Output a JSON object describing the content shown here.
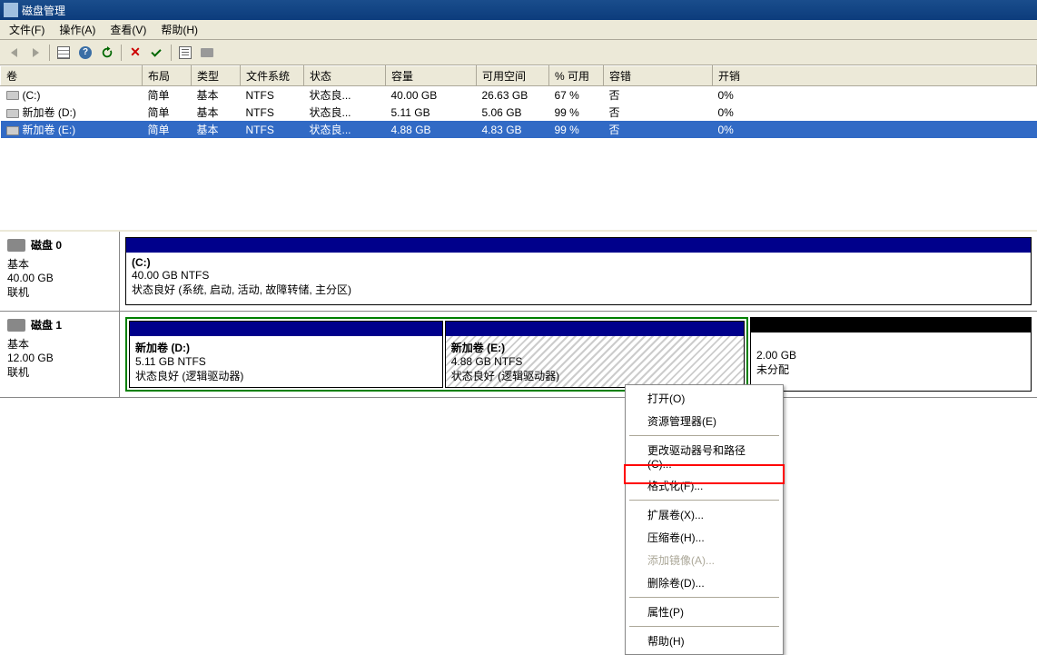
{
  "window": {
    "title": "磁盘管理"
  },
  "menu": {
    "file": "文件(F)",
    "action": "操作(A)",
    "view": "查看(V)",
    "help": "帮助(H)"
  },
  "columns": {
    "volume": "卷",
    "layout": "布局",
    "type": "类型",
    "fs": "文件系统",
    "status": "状态",
    "capacity": "容量",
    "free": "可用空间",
    "pct_free": "% 可用",
    "fault": "容错",
    "overhead": "开销"
  },
  "volumes": [
    {
      "name": "(C:)",
      "layout": "简单",
      "type": "基本",
      "fs": "NTFS",
      "status": "状态良...",
      "capacity": "40.00 GB",
      "free": "26.63 GB",
      "pct": "67 %",
      "fault": "否",
      "overhead": "0%",
      "selected": false
    },
    {
      "name": "新加卷 (D:)",
      "layout": "简单",
      "type": "基本",
      "fs": "NTFS",
      "status": "状态良...",
      "capacity": "5.11 GB",
      "free": "5.06 GB",
      "pct": "99 %",
      "fault": "否",
      "overhead": "0%",
      "selected": false
    },
    {
      "name": "新加卷 (E:)",
      "layout": "简单",
      "type": "基本",
      "fs": "NTFS",
      "status": "状态良...",
      "capacity": "4.88 GB",
      "free": "4.83 GB",
      "pct": "99 %",
      "fault": "否",
      "overhead": "0%",
      "selected": true
    }
  ],
  "disks": {
    "disk0": {
      "title": "磁盘 0",
      "type": "基本",
      "size": "40.00 GB",
      "state": "联机",
      "part_c": {
        "title": "(C:)",
        "line2": "40.00 GB NTFS",
        "line3": "状态良好 (系统, 启动, 活动, 故障转储, 主分区)"
      }
    },
    "disk1": {
      "title": "磁盘 1",
      "type": "基本",
      "size": "12.00 GB",
      "state": "联机",
      "part_d": {
        "title": "新加卷   (D:)",
        "line2": "5.11 GB NTFS",
        "line3": "状态良好 (逻辑驱动器)"
      },
      "part_e": {
        "title": "新加卷   (E:)",
        "line2": "4.88 GB NTFS",
        "line3": "状态良好 (逻辑驱动器)"
      },
      "unalloc": {
        "line2": "2.00 GB",
        "line3": "未分配"
      }
    }
  },
  "context": {
    "open": "打开(O)",
    "explorer": "资源管理器(E)",
    "change_letter": "更改驱动器号和路径(C)...",
    "format": "格式化(F)...",
    "extend": "扩展卷(X)...",
    "shrink": "压缩卷(H)...",
    "mirror": "添加镜像(A)...",
    "delete": "删除卷(D)...",
    "properties": "属性(P)",
    "help": "帮助(H)"
  }
}
